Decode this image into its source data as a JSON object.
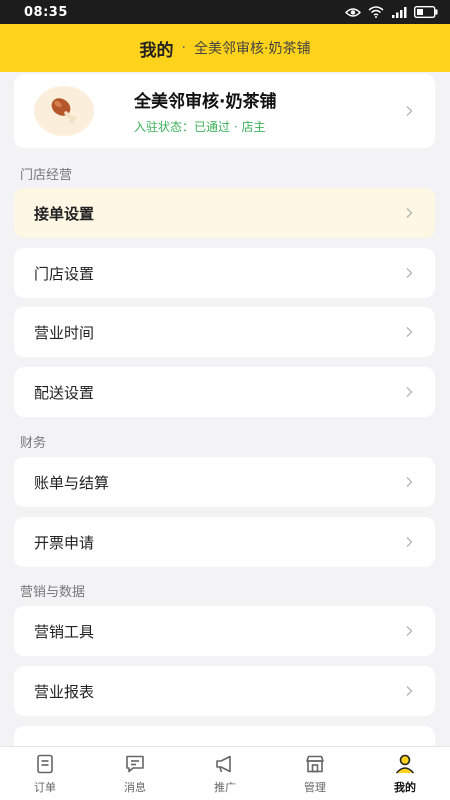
{
  "status_bar": {
    "time": "08:35"
  },
  "header": {
    "title": "我的",
    "separator": "·",
    "subtitle": "全美邻审核·奶茶铺"
  },
  "profile": {
    "store_name": "全美邻审核·奶茶铺",
    "status_text": "入驻状态：已通过 · 店主",
    "avatar_icon": "drumstick-icon"
  },
  "sections": {
    "store": {
      "label": "门店经营",
      "items": [
        "接单设置",
        "门店设置",
        "营业时间",
        "配送设置"
      ]
    },
    "finance": {
      "label": "财务",
      "items": [
        "账单与结算",
        "开票申请"
      ]
    },
    "marketing": {
      "label": "营销与数据",
      "items": [
        "营销工具",
        "营业报表"
      ]
    }
  },
  "tabs": [
    {
      "label": "订单",
      "icon": "order-icon"
    },
    {
      "label": "消息",
      "icon": "message-icon"
    },
    {
      "label": "推广",
      "icon": "megaphone-icon"
    },
    {
      "label": "管理",
      "icon": "store-icon"
    },
    {
      "label": "我的",
      "icon": "user-icon",
      "active": true
    }
  ],
  "colors": {
    "accent": "#ffd21c",
    "status_green": "#3db25b",
    "active_row": "#fdf7e4"
  }
}
